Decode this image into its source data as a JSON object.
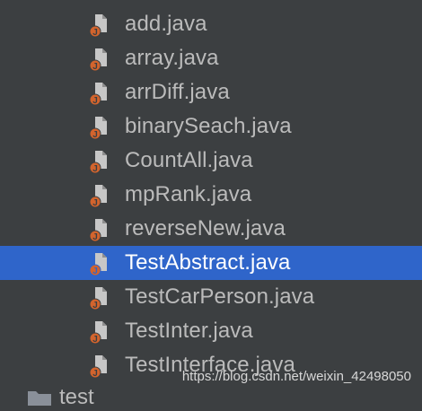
{
  "project_tree": {
    "files": [
      {
        "name": "add.java",
        "icon": "java-class-file-icon",
        "selected": false
      },
      {
        "name": "array.java",
        "icon": "java-class-file-icon",
        "selected": false
      },
      {
        "name": "arrDiff.java",
        "icon": "java-class-file-icon",
        "selected": false
      },
      {
        "name": "binarySeach.java",
        "icon": "java-class-file-icon",
        "selected": false
      },
      {
        "name": "CountAll.java",
        "icon": "java-class-file-icon",
        "selected": false
      },
      {
        "name": "mpRank.java",
        "icon": "java-class-file-icon",
        "selected": false
      },
      {
        "name": "reverseNew.java",
        "icon": "java-class-file-icon",
        "selected": false
      },
      {
        "name": "TestAbstract.java",
        "icon": "java-class-file-icon",
        "selected": true
      },
      {
        "name": "TestCarPerson.java",
        "icon": "java-class-file-icon",
        "selected": false
      },
      {
        "name": "TestInter.java",
        "icon": "java-class-file-icon",
        "selected": false
      },
      {
        "name": "TestInterface.java",
        "icon": "java-class-file-icon",
        "selected": false
      }
    ],
    "partial_folder": {
      "label": "test",
      "icon": "folder-icon"
    }
  },
  "watermark": "https://blog.csdn.net/weixin_42498050",
  "colors": {
    "background": "#3c3f41",
    "selection": "#2f65ca",
    "text": "#bbbbbb",
    "selected_text": "#ffffff",
    "java_badge": "#d3642d"
  }
}
